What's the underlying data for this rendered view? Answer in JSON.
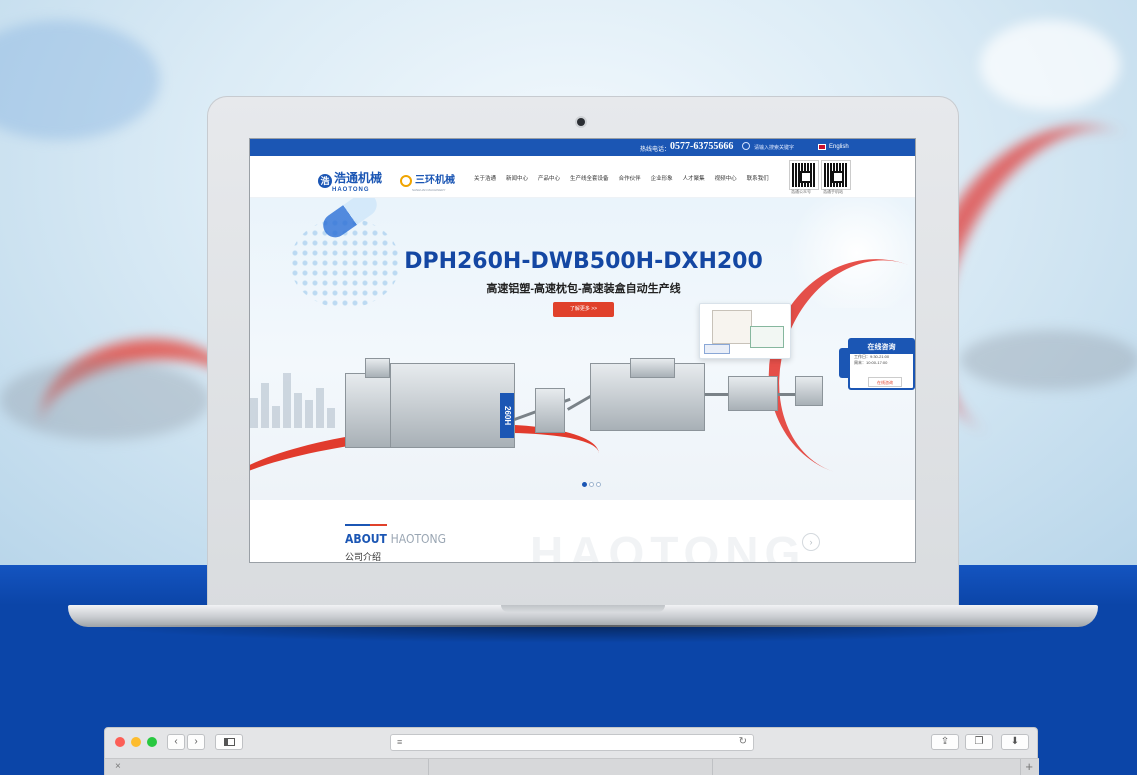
{
  "site": {
    "topbar": {
      "hotline_label": "热线电话：",
      "hotline": "0577-63755666",
      "search_placeholder": "请输入搜索关键字",
      "language": "English"
    },
    "logos": {
      "logo1_cn": "浩通机械",
      "logo1_en": "HAOTONG",
      "logo2_cn": "三环机械",
      "logo2_en": "SANHUAN MACHINERY"
    },
    "menu": [
      "关于浩通",
      "新闻中心",
      "产品中心",
      "生产线全套设备",
      "合作伙伴",
      "企业形象",
      "人才聚集",
      "视频中心",
      "联系我们"
    ],
    "qr": {
      "left_caption": "浩通公众号",
      "right_caption": "浩通手机站"
    },
    "hero": {
      "title": "DPH260H-DWB500H-DXH200",
      "subtitle": "高速铝塑-高速枕包-高速装盒自动生产线",
      "button": "了解更多 >>",
      "machine_badge": "260H",
      "slide_count": 3,
      "active_slide": 1
    },
    "consult": {
      "title": "在线咨询",
      "line1": "工作日：9:30-21:00",
      "line2": "周末：10:00-17:00",
      "button": "在线咨询"
    },
    "about": {
      "heading_en": "ABOUT",
      "heading_en2": "HAOTONG",
      "heading_cn": "公司介绍",
      "watermark": "HAOTONG",
      "arrow": "›"
    }
  },
  "browser": {
    "back": "‹",
    "forward": "›",
    "new_tab": "+",
    "close_tab": "×"
  },
  "colors": {
    "brand_blue": "#1b56b4",
    "accent_red": "#e0412b",
    "scene_blue": "#0b45a8"
  }
}
